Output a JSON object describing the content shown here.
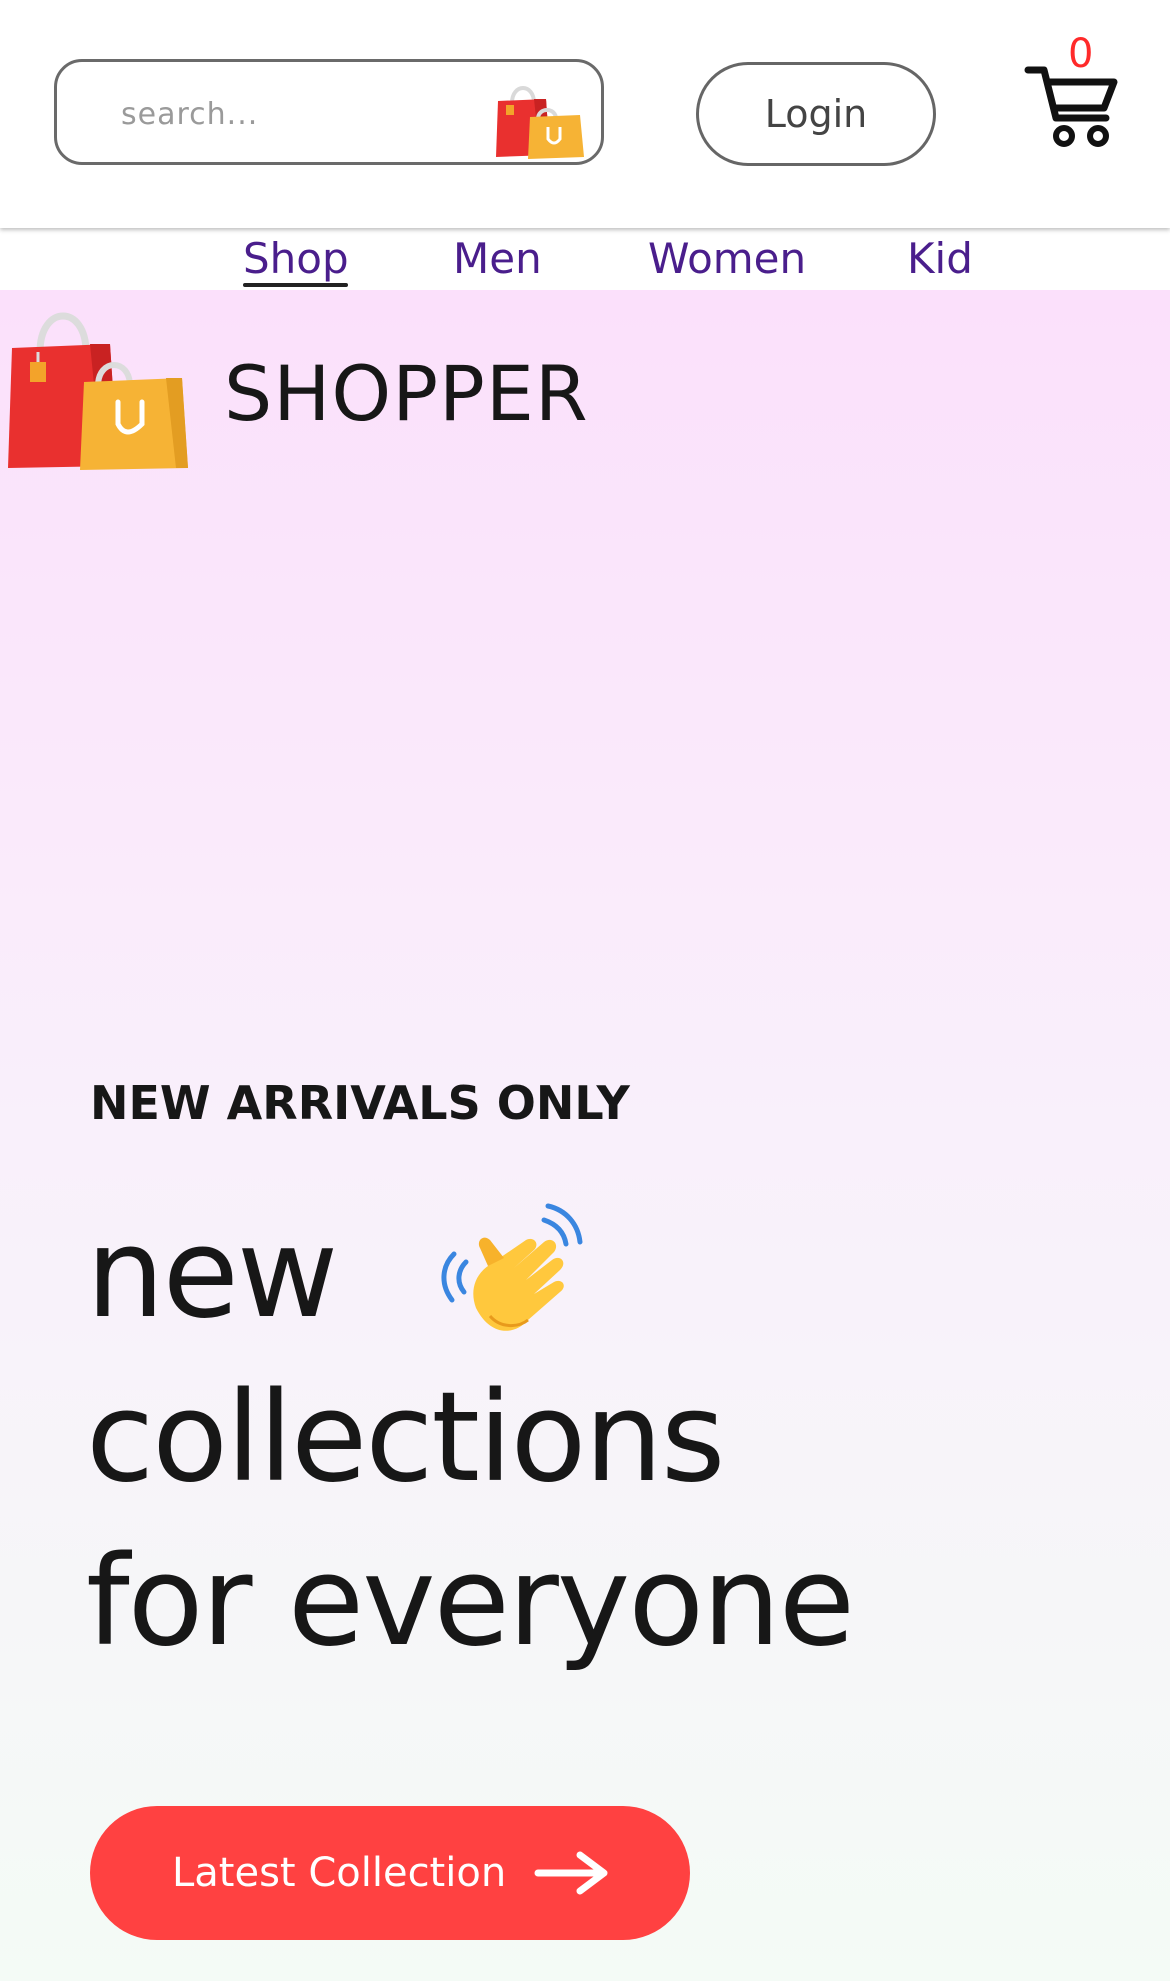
{
  "header": {
    "search": {
      "placeholder": "search...",
      "value": ""
    },
    "login_label": "Login",
    "cart_count": "0"
  },
  "nav": {
    "items": [
      {
        "label": "Shop",
        "active": true
      },
      {
        "label": "Men",
        "active": false
      },
      {
        "label": "Women",
        "active": false
      },
      {
        "label": "Kid",
        "active": false
      }
    ]
  },
  "hero": {
    "brand": "SHOPPER",
    "eyebrow": "NEW ARRIVALS ONLY",
    "headline": [
      "new",
      "collections",
      "for everyone"
    ],
    "cta_label": "Latest Collection"
  },
  "icons": {
    "search_bag": "shopping-bag-icon",
    "cart": "cart-icon",
    "logo": "shopping-bag-logo-icon",
    "wave": "waving-hand-icon",
    "cta_arrow": "arrow-right-icon"
  },
  "colors": {
    "nav_text": "#4a1e8c",
    "cta_background": "#ff4141",
    "cart_count": "#ff2a2a",
    "hero_gradient_top": "#fbe0fb",
    "hero_gradient_bottom": "#f4fbf6"
  }
}
